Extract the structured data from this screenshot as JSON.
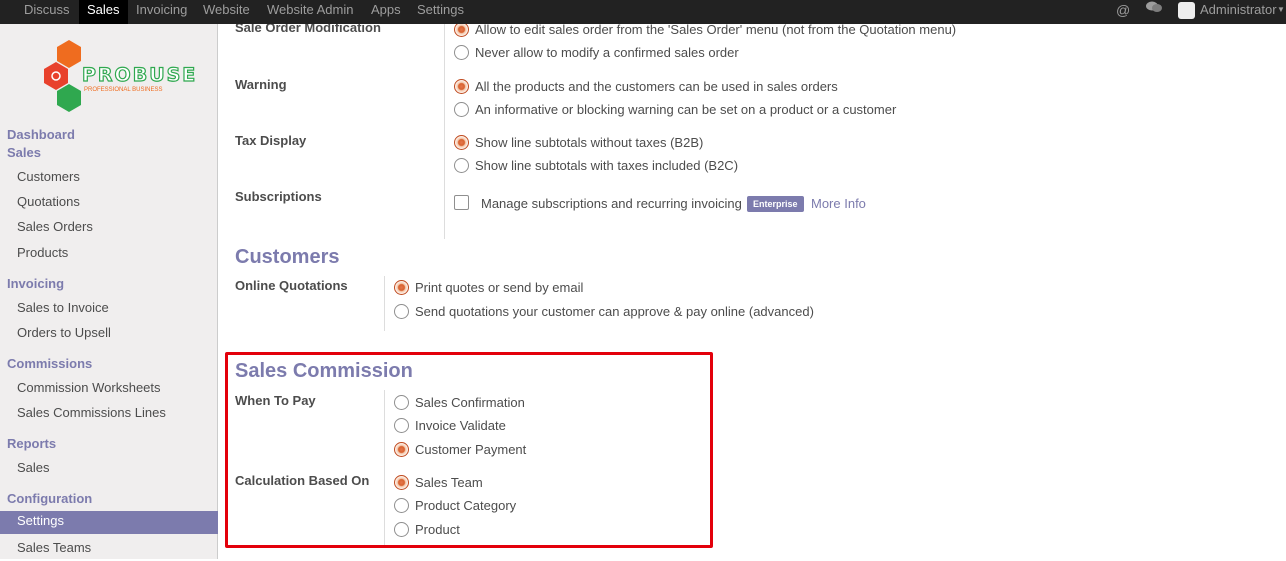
{
  "topbar": {
    "menu": [
      "Discuss",
      "Sales",
      "Invoicing",
      "Website",
      "Website Admin",
      "Apps",
      "Settings"
    ],
    "active": "Sales",
    "user": "Administrator"
  },
  "logo": {
    "name": "PROBUSE",
    "tagline": "PROFESSIONAL BUSINESS"
  },
  "sidebar": {
    "dashboard": "Dashboard",
    "sales": {
      "title": "Sales",
      "items": [
        "Customers",
        "Quotations",
        "Sales Orders",
        "Products"
      ]
    },
    "invoicing": {
      "title": "Invoicing",
      "items": [
        "Sales to Invoice",
        "Orders to Upsell"
      ]
    },
    "commissions": {
      "title": "Commissions",
      "items": [
        "Commission Worksheets",
        "Sales Commissions Lines"
      ]
    },
    "reports": {
      "title": "Reports",
      "items": [
        "Sales"
      ]
    },
    "configuration": {
      "title": "Configuration",
      "items": [
        "Settings",
        "Sales Teams"
      ],
      "active": "Settings"
    }
  },
  "settings": {
    "sale_order_mod": {
      "label": "Sale Order Modification",
      "options": [
        "Allow to edit sales order from the 'Sales Order' menu (not from the Quotation menu)",
        "Never allow to modify a confirmed sales order"
      ],
      "selected": 0
    },
    "warning": {
      "label": "Warning",
      "options": [
        "All the products and the customers can be used in sales orders",
        "An informative or blocking warning can be set on a product or a customer"
      ],
      "selected": 0
    },
    "tax_display": {
      "label": "Tax Display",
      "options": [
        "Show line subtotals without taxes (B2B)",
        "Show line subtotals with taxes included (B2C)"
      ],
      "selected": 0
    },
    "subscriptions": {
      "label": "Subscriptions",
      "text": "Manage subscriptions and recurring invoicing",
      "badge": "Enterprise",
      "more": "More Info"
    },
    "customers_heading": "Customers",
    "online_quotations": {
      "label": "Online Quotations",
      "options": [
        "Print quotes or send by email",
        "Send quotations your customer can approve & pay online (advanced)"
      ],
      "selected": 0
    },
    "commission_heading": "Sales Commission",
    "when_to_pay": {
      "label": "When To Pay",
      "options": [
        "Sales Confirmation",
        "Invoice Validate",
        "Customer Payment"
      ],
      "selected": 2
    },
    "calc_based_on": {
      "label": "Calculation Based On",
      "options": [
        "Sales Team",
        "Product Category",
        "Product"
      ],
      "selected": 0
    }
  },
  "colors": {
    "accent": "#7c7bad",
    "radio_on": "#d8622f",
    "highlight": "#e3000b",
    "topbar": "#222222"
  }
}
